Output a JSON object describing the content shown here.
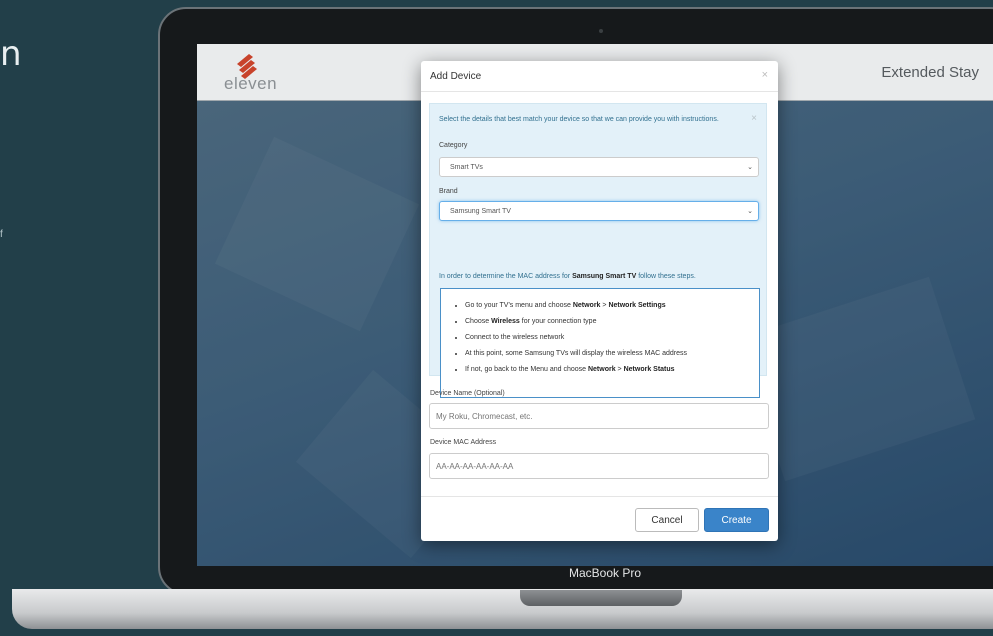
{
  "background_fragments": {
    "heading_char": "n",
    "side_char": "f"
  },
  "device_label": "MacBook Pro",
  "header": {
    "brand": "eleven",
    "brand_color": "#c8432b",
    "property": "Extended Stay"
  },
  "modal": {
    "title": "Add Device",
    "close_icon": "×",
    "info": {
      "intro": "Select the details that best match your device so that we can provide you with instructions.",
      "close_icon": "×",
      "category_label": "Category",
      "category_value": "Smart TVs",
      "brand_label": "Brand",
      "brand_value": "Samsung Smart TV",
      "mac_intro_prefix": "In order to determine the MAC address for ",
      "mac_intro_device": "Samsung Smart TV",
      "mac_intro_suffix": " follow these steps.",
      "steps": [
        {
          "pre": "Go to your TV's menu and choose ",
          "b1": "Network",
          "mid": " > ",
          "b2": "Network Settings",
          "post": ""
        },
        {
          "pre": "Choose ",
          "b1": "Wireless",
          "mid": "",
          "b2": "",
          "post": " for your connection type"
        },
        {
          "pre": "Connect to the wireless network",
          "b1": "",
          "mid": "",
          "b2": "",
          "post": ""
        },
        {
          "pre": "At this point, some Samsung TVs will display the wireless MAC address",
          "b1": "",
          "mid": "",
          "b2": "",
          "post": ""
        },
        {
          "pre": "If not, go back to the Menu and choose ",
          "b1": "Network",
          "mid": " > ",
          "b2": "Network Status",
          "post": ""
        }
      ]
    },
    "device_name_label": "Device Name (Optional)",
    "device_name_placeholder": "My Roku, Chromecast, etc.",
    "device_mac_label": "Device MAC Address",
    "device_mac_placeholder": "AA-AA-AA-AA-AA-AA",
    "cancel_label": "Cancel",
    "create_label": "Create",
    "accent_color": "#3a84c9"
  }
}
